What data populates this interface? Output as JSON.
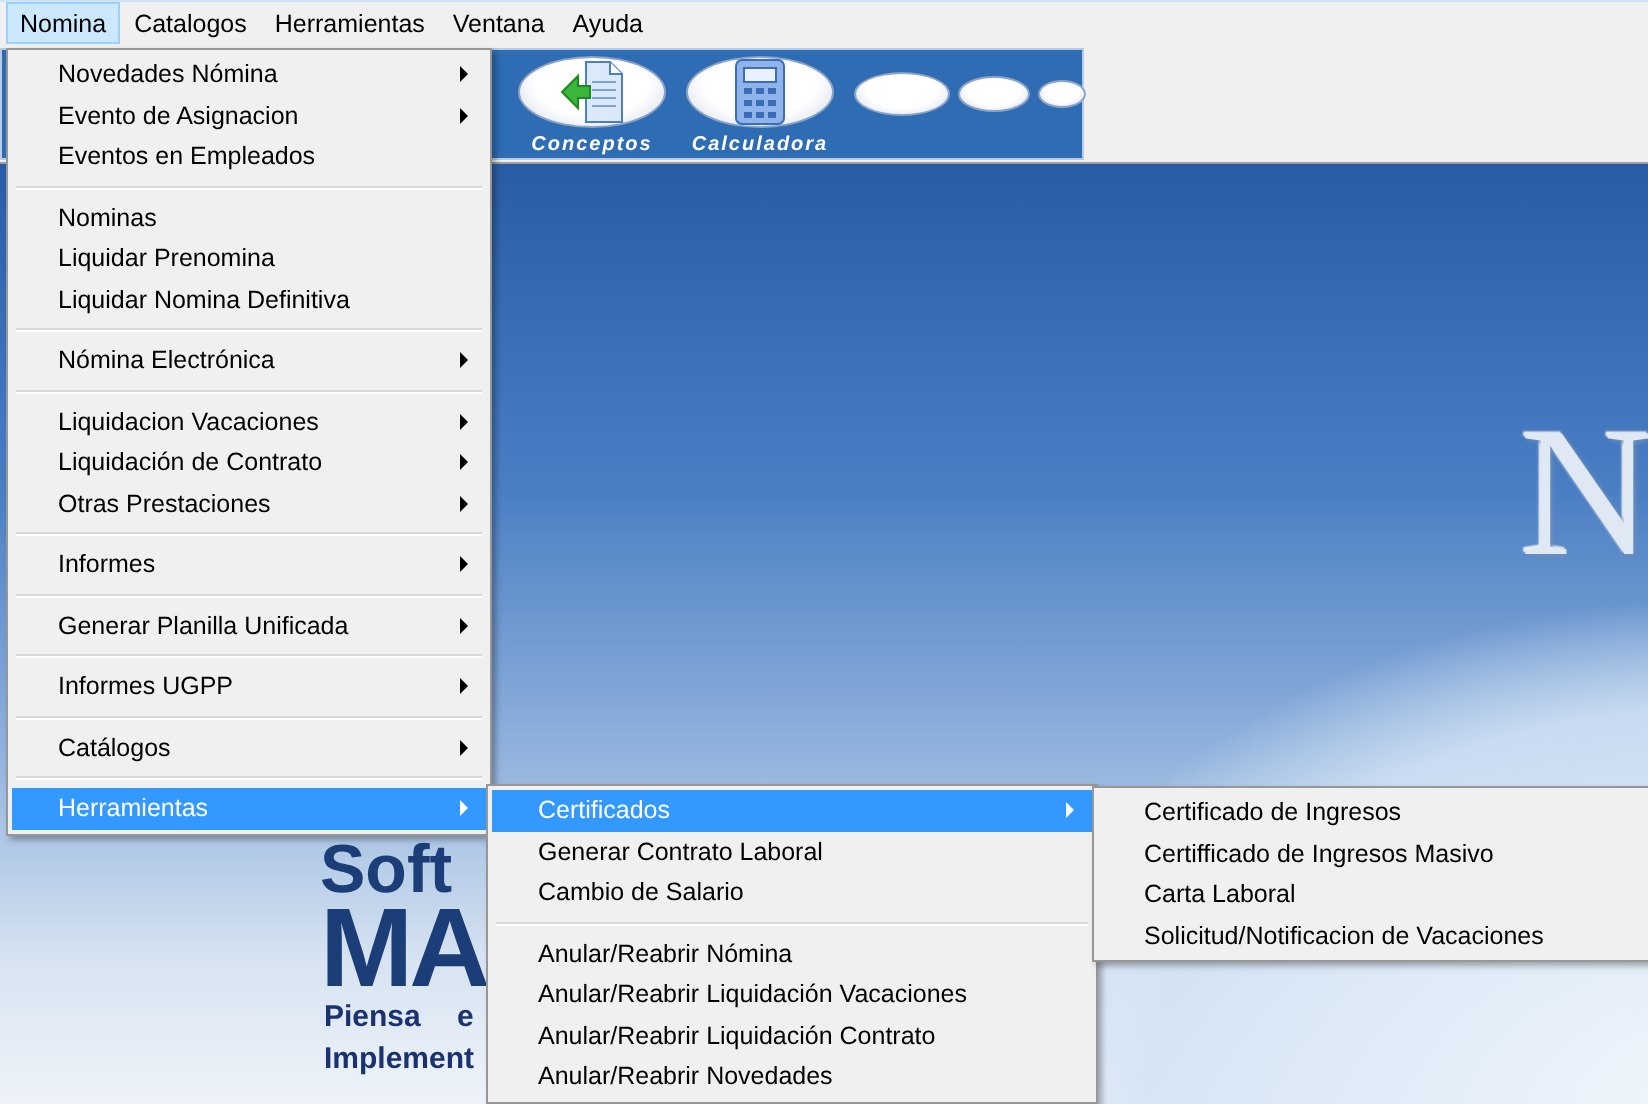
{
  "menubar": [
    {
      "label": "Nomina",
      "selected": true
    },
    {
      "label": "Catalogos",
      "selected": false
    },
    {
      "label": "Herramientas",
      "selected": false
    },
    {
      "label": "Ventana",
      "selected": false
    },
    {
      "label": "Ayuda",
      "selected": false
    }
  ],
  "toolbar": {
    "buttons": [
      {
        "kind": "document",
        "label": "Conceptos"
      },
      {
        "kind": "calculator",
        "label": "Calculadora"
      },
      {
        "kind": "blank"
      },
      {
        "kind": "blank"
      },
      {
        "kind": "blank"
      }
    ]
  },
  "splash": {
    "logo_letter": "N",
    "brand_lines": [
      "Soft",
      "MA"
    ],
    "tagline_lines": [
      "Piensa e",
      "Implement"
    ]
  },
  "menu": {
    "items": [
      {
        "kind": "item",
        "label": "Novedades Nómina",
        "has_submenu": true,
        "selected": false
      },
      {
        "kind": "item",
        "label": "Evento de Asignacion",
        "has_submenu": true,
        "selected": false
      },
      {
        "kind": "item",
        "label": "Eventos en Empleados",
        "has_submenu": false,
        "selected": false
      },
      {
        "kind": "separator"
      },
      {
        "kind": "item",
        "label": "Nominas",
        "has_submenu": false,
        "selected": false
      },
      {
        "kind": "item",
        "label": "Liquidar Prenomina",
        "has_submenu": false,
        "selected": false
      },
      {
        "kind": "item",
        "label": "Liquidar Nomina Definitiva",
        "has_submenu": false,
        "selected": false
      },
      {
        "kind": "separator"
      },
      {
        "kind": "item",
        "label": "Nómina Electrónica",
        "has_submenu": true,
        "selected": false
      },
      {
        "kind": "separator"
      },
      {
        "kind": "item",
        "label": "Liquidacion Vacaciones",
        "has_submenu": true,
        "selected": false
      },
      {
        "kind": "item",
        "label": "Liquidación de Contrato",
        "has_submenu": true,
        "selected": false
      },
      {
        "kind": "item",
        "label": "Otras Prestaciones",
        "has_submenu": true,
        "selected": false
      },
      {
        "kind": "separator"
      },
      {
        "kind": "item",
        "label": "Informes",
        "has_submenu": true,
        "selected": false
      },
      {
        "kind": "separator"
      },
      {
        "kind": "item",
        "label": "Generar Planilla Unificada",
        "has_submenu": true,
        "selected": false
      },
      {
        "kind": "separator"
      },
      {
        "kind": "item",
        "label": "Informes UGPP",
        "has_submenu": true,
        "selected": false
      },
      {
        "kind": "separator"
      },
      {
        "kind": "item",
        "label": "Catálogos",
        "has_submenu": true,
        "selected": false
      },
      {
        "kind": "separator"
      },
      {
        "kind": "item",
        "label": "Herramientas",
        "has_submenu": true,
        "selected": true,
        "children": [
          {
            "kind": "item",
            "label": "Certificados",
            "has_submenu": true,
            "selected": true,
            "children": [
              {
                "kind": "item",
                "label": "Certificado de Ingresos",
                "has_submenu": false,
                "selected": false
              },
              {
                "kind": "item",
                "label": "Certifficado de Ingresos Masivo",
                "has_submenu": false,
                "selected": false
              },
              {
                "kind": "item",
                "label": "Carta Laboral",
                "has_submenu": false,
                "selected": false
              },
              {
                "kind": "item",
                "label": "Solicitud/Notificacion de Vacaciones",
                "has_submenu": false,
                "selected": false
              }
            ]
          },
          {
            "kind": "item",
            "label": "Generar Contrato Laboral",
            "has_submenu": false,
            "selected": false
          },
          {
            "kind": "item",
            "label": "Cambio de Salario",
            "has_submenu": false,
            "selected": false
          },
          {
            "kind": "separator"
          },
          {
            "kind": "item",
            "label": "Anular/Reabrir Nómina",
            "has_submenu": false,
            "selected": false
          },
          {
            "kind": "item",
            "label": "Anular/Reabrir Liquidación Vacaciones",
            "has_submenu": false,
            "selected": false
          },
          {
            "kind": "item",
            "label": "Anular/Reabrir Liquidación Contrato",
            "has_submenu": false,
            "selected": false
          },
          {
            "kind": "item",
            "label": "Anular/Reabrir Novedades",
            "has_submenu": false,
            "selected": false
          }
        ]
      }
    ]
  }
}
